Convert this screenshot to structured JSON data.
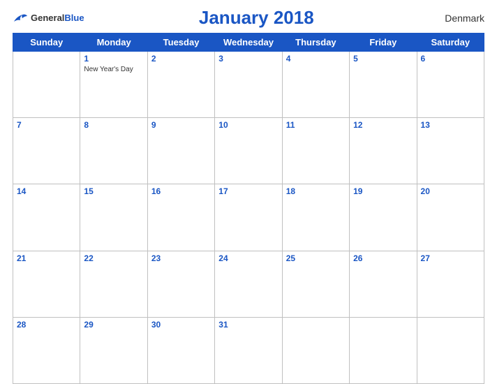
{
  "header": {
    "logo_general": "General",
    "logo_blue": "Blue",
    "title": "January 2018",
    "country": "Denmark"
  },
  "days_of_week": [
    "Sunday",
    "Monday",
    "Tuesday",
    "Wednesday",
    "Thursday",
    "Friday",
    "Saturday"
  ],
  "weeks": [
    [
      {
        "day": "",
        "holiday": ""
      },
      {
        "day": "1",
        "holiday": "New Year's Day"
      },
      {
        "day": "2",
        "holiday": ""
      },
      {
        "day": "3",
        "holiday": ""
      },
      {
        "day": "4",
        "holiday": ""
      },
      {
        "day": "5",
        "holiday": ""
      },
      {
        "day": "6",
        "holiday": ""
      }
    ],
    [
      {
        "day": "7",
        "holiday": ""
      },
      {
        "day": "8",
        "holiday": ""
      },
      {
        "day": "9",
        "holiday": ""
      },
      {
        "day": "10",
        "holiday": ""
      },
      {
        "day": "11",
        "holiday": ""
      },
      {
        "day": "12",
        "holiday": ""
      },
      {
        "day": "13",
        "holiday": ""
      }
    ],
    [
      {
        "day": "14",
        "holiday": ""
      },
      {
        "day": "15",
        "holiday": ""
      },
      {
        "day": "16",
        "holiday": ""
      },
      {
        "day": "17",
        "holiday": ""
      },
      {
        "day": "18",
        "holiday": ""
      },
      {
        "day": "19",
        "holiday": ""
      },
      {
        "day": "20",
        "holiday": ""
      }
    ],
    [
      {
        "day": "21",
        "holiday": ""
      },
      {
        "day": "22",
        "holiday": ""
      },
      {
        "day": "23",
        "holiday": ""
      },
      {
        "day": "24",
        "holiday": ""
      },
      {
        "day": "25",
        "holiday": ""
      },
      {
        "day": "26",
        "holiday": ""
      },
      {
        "day": "27",
        "holiday": ""
      }
    ],
    [
      {
        "day": "28",
        "holiday": ""
      },
      {
        "day": "29",
        "holiday": ""
      },
      {
        "day": "30",
        "holiday": ""
      },
      {
        "day": "31",
        "holiday": ""
      },
      {
        "day": "",
        "holiday": ""
      },
      {
        "day": "",
        "holiday": ""
      },
      {
        "day": "",
        "holiday": ""
      }
    ]
  ]
}
